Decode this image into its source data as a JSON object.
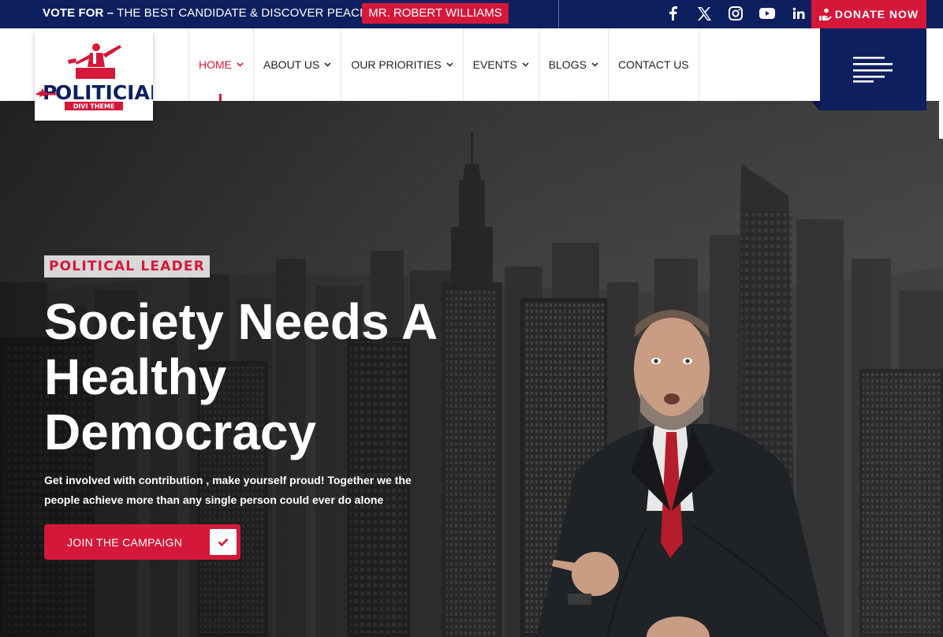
{
  "topbar": {
    "vote_prefix": "VOTE FOR –",
    "vote_text": " THE BEST CANDIDATE & DISCOVER PEACE",
    "candidate": "MR. ROBERT WILLIAMS",
    "social": [
      "facebook-icon",
      "x-twitter-icon",
      "instagram-icon",
      "youtube-icon",
      "linkedin-icon"
    ],
    "donate_label": "DONATE NOW"
  },
  "logo": {
    "brand": "POLITICIAN",
    "tagline": "DIVI THEME"
  },
  "nav": {
    "items": [
      {
        "label": "HOME",
        "has_dropdown": true,
        "active": true
      },
      {
        "label": "ABOUT US",
        "has_dropdown": true
      },
      {
        "label": "OUR PRIORITIES",
        "has_dropdown": true
      },
      {
        "label": "EVENTS",
        "has_dropdown": true
      },
      {
        "label": "BLOGS",
        "has_dropdown": true
      },
      {
        "label": "CONTACT US",
        "has_dropdown": false
      }
    ]
  },
  "hero": {
    "tag": "POLITICAL LEADER",
    "headline": "Society Needs A Healthy Democracy",
    "subtext": "Get involved with contribution , make yourself proud! Together we the people achieve more than any single person could ever do alone",
    "cta_label": "JOIN THE CAMPAIGN"
  },
  "colors": {
    "navy": "#0d1f5e",
    "red": "#d5183a",
    "white": "#ffffff"
  }
}
